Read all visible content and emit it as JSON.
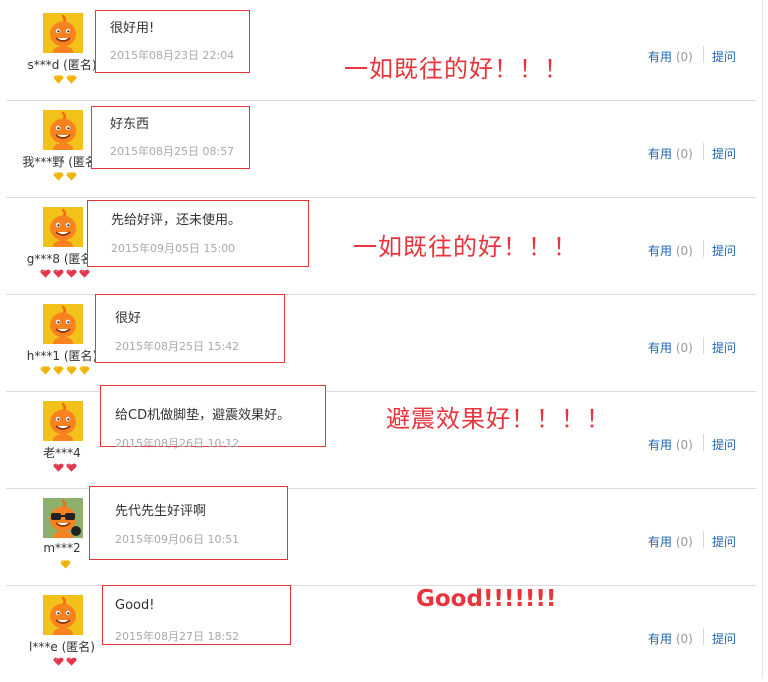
{
  "reviews": [
    {
      "user": "s***d (匿名)",
      "content": "很好用!",
      "time": "2015年08月23日 22:04",
      "useful_label": "有用",
      "useful_count": "(0)",
      "ask_label": "提问",
      "annotation": "一如既往的好！！！",
      "badge": {
        "count": 2,
        "color": "#f0b400",
        "shape": "diamond"
      },
      "avatar": "mascot"
    },
    {
      "user": "我***野 (匿名)",
      "content": "好东西",
      "time": "2015年08月25日 08:57",
      "useful_label": "有用",
      "useful_count": "(0)",
      "ask_label": "提问",
      "annotation": "",
      "badge": {
        "count": 2,
        "color": "#f0b400",
        "shape": "diamond"
      },
      "avatar": "mascot"
    },
    {
      "user": "g***8 (匿名)",
      "content": "先给好评，还未使用。",
      "time": "2015年09月05日 15:00",
      "useful_label": "有用",
      "useful_count": "(0)",
      "ask_label": "提问",
      "annotation": "一如既往的好！！！",
      "badge": {
        "count": 4,
        "color": "#e4364a",
        "shape": "heart"
      },
      "avatar": "mascot"
    },
    {
      "user": "h***1 (匿名)",
      "content": "很好",
      "time": "2015年08月25日 15:42",
      "useful_label": "有用",
      "useful_count": "(0)",
      "ask_label": "提问",
      "annotation": "",
      "badge": {
        "count": 4,
        "color": "#f0b400",
        "shape": "diamond"
      },
      "avatar": "mascot"
    },
    {
      "user": "老***4",
      "content": "给CD机做脚垫，避震效果好。",
      "time": "2015年08月26日 10:12",
      "useful_label": "有用",
      "useful_count": "(0)",
      "ask_label": "提问",
      "annotation": "避震效果好！！！！",
      "badge": {
        "count": 2,
        "color": "#e4364a",
        "shape": "heart"
      },
      "avatar": "mascot"
    },
    {
      "user": "m***2",
      "content": "先代先生好评啊",
      "time": "2015年09月06日 10:51",
      "useful_label": "有用",
      "useful_count": "(0)",
      "ask_label": "提问",
      "annotation": "",
      "badge": {
        "count": 1,
        "color": "#f0b400",
        "shape": "diamond"
      },
      "avatar": "mascot-glasses"
    },
    {
      "user": "l***e (匿名)",
      "content": "Good!",
      "time": "2015年08月27日 18:52",
      "useful_label": "有用",
      "useful_count": "(0)",
      "ask_label": "提问",
      "annotation": "Good!!!!!!!",
      "badge": {
        "count": 2,
        "color": "#e4364a",
        "shape": "heart"
      },
      "avatar": "mascot"
    }
  ]
}
